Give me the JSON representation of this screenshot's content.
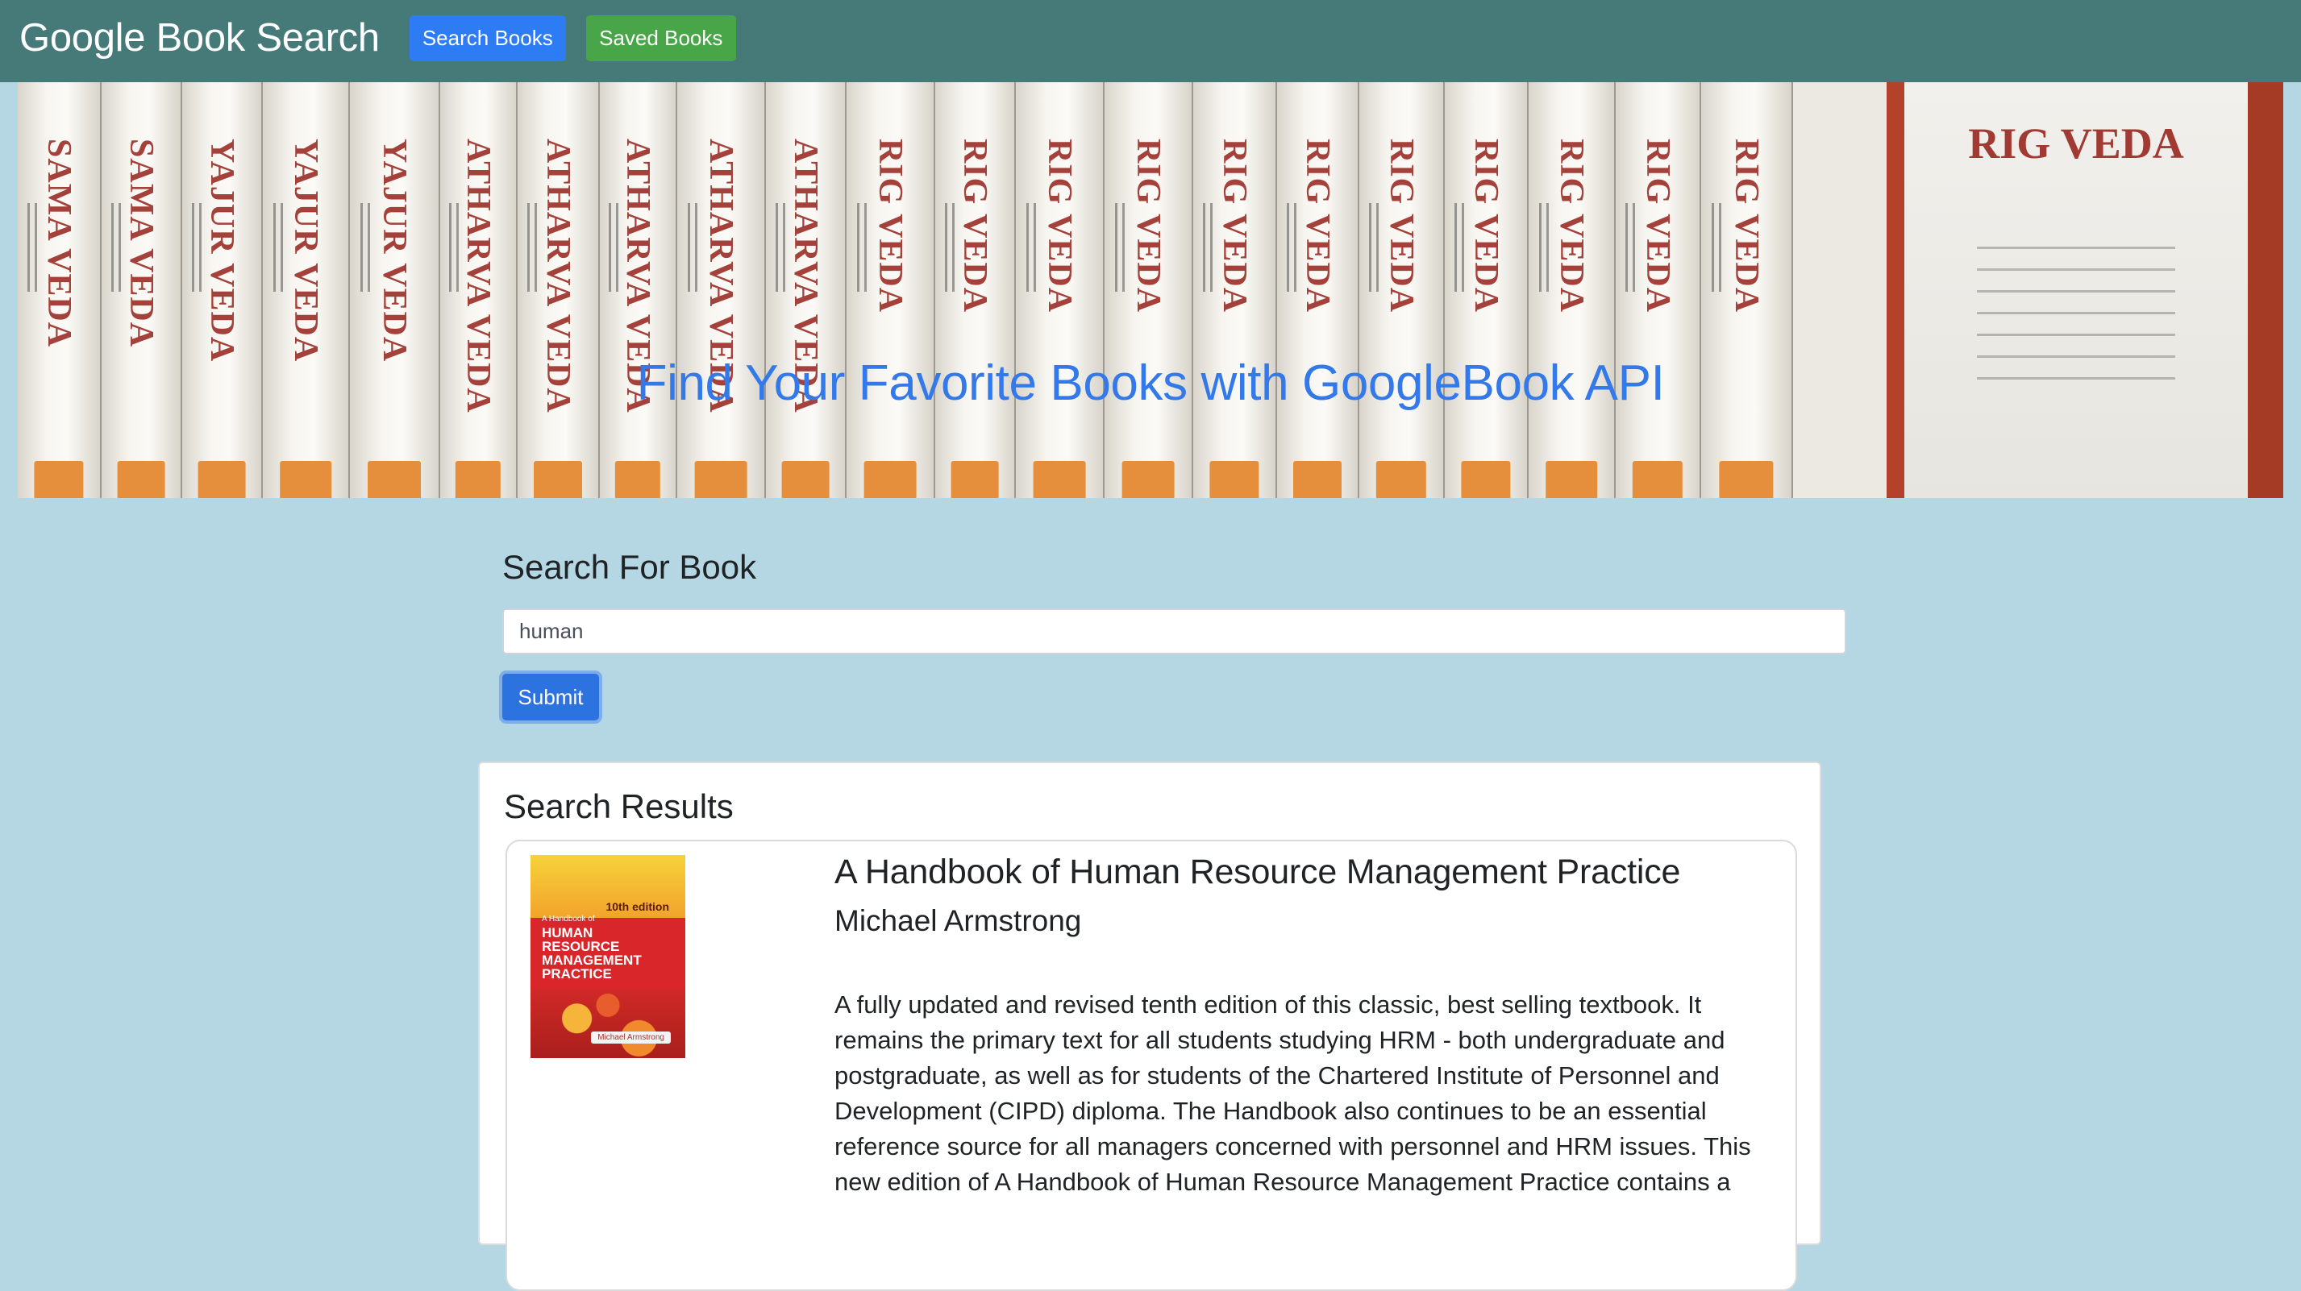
{
  "navbar": {
    "brand": "Google Book Search",
    "search_label": "Search Books",
    "saved_label": "Saved Books"
  },
  "hero": {
    "title": "Find Your Favorite Books with GoogleBook API",
    "spines": [
      "SAMA VEDA",
      "SAMA VEDA",
      "YAJUR VEDA",
      "YAJUR VEDA",
      "YAJUR VEDA",
      "ATHARVA VEDA",
      "ATHARVA VEDA",
      "ATHARVA VEDA",
      "ATHARVA VEDA",
      "ATHARVA VEDA",
      "RIG VEDA",
      "RIG VEDA",
      "RIG VEDA",
      "RIG VEDA",
      "RIG VEDA",
      "RIG VEDA",
      "RIG VEDA",
      "RIG VEDA",
      "RIG VEDA",
      "RIG VEDA",
      "RIG VEDA"
    ],
    "cover_title": "RIG VEDA"
  },
  "search": {
    "heading": "Search For Book",
    "value": "human",
    "submit_label": "Submit"
  },
  "results": {
    "heading": "Search Results",
    "books": [
      {
        "title": "A Handbook of Human Resource Management Practice",
        "author": "Michael Armstrong",
        "description": "A fully updated and revised tenth edition of this classic, best selling textbook. It remains the primary text for all students studying HRM - both undergraduate and postgraduate, as well as for students of the Chartered Institute of Personnel and Development (CIPD) diploma. The Handbook also continues to be an essential reference source for all managers concerned with personnel and HRM issues. This new edition of A Handbook of Human Resource Management Practice contains a",
        "cover": {
          "small": "A Handbook of",
          "lines": [
            "HUMAN",
            "RESOURCE",
            "MANAGEMENT",
            "PRACTICE"
          ],
          "edition": "10th edition",
          "author": "Michael Armstrong"
        }
      }
    ]
  }
}
